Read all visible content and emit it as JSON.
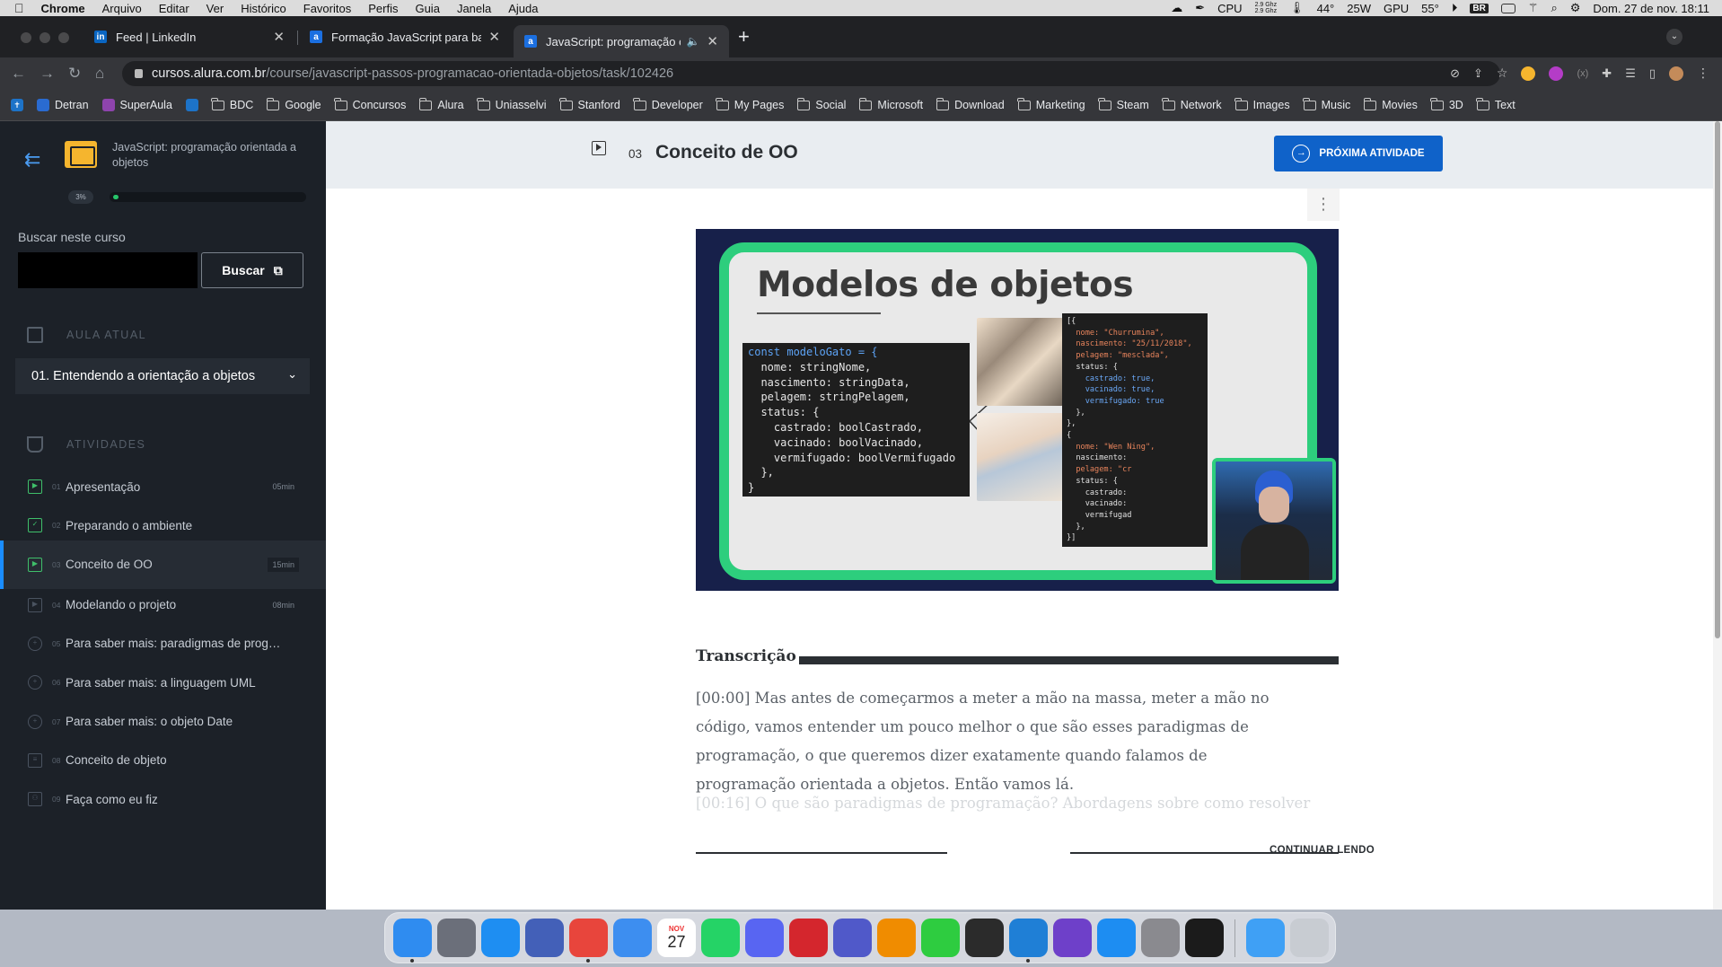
{
  "menubar": {
    "app": "Chrome",
    "menus": [
      "Arquivo",
      "Editar",
      "Ver",
      "Histórico",
      "Favoritos",
      "Perfis",
      "Guia",
      "Janela",
      "Ajuda"
    ],
    "cpu_label": "CPU",
    "cpu_freq_1": "2.9 Ghz",
    "cpu_freq_2": "2.9 Ghz",
    "temp": "44°",
    "power": "25W",
    "gpu_label": "GPU",
    "gpu_temp": "55°",
    "keyboard": "BR",
    "datetime": "Dom. 27 de nov.  18:11"
  },
  "tabs": [
    {
      "title": "Feed | LinkedIn",
      "favicon": "linkedin-icon",
      "color": "#0a66c2"
    },
    {
      "title": "Formação JavaScript para back-end",
      "favicon": "alura-icon",
      "color": "#1b6fe0"
    },
    {
      "title": "JavaScript: programação orientada",
      "favicon": "alura-icon",
      "color": "#1b6fe0",
      "active": true
    }
  ],
  "omnibox": {
    "host": "cursos.alura.com.br",
    "path": "/course/javascript-passos-programacao-orientada-objetos/task/102426"
  },
  "bookmarks": [
    {
      "label": "",
      "type": "plus"
    },
    {
      "label": "Detran",
      "type": "fav",
      "color": "#2a6bd1"
    },
    {
      "label": "SuperAula",
      "type": "fav",
      "color": "#8e44ad"
    },
    {
      "label": "",
      "type": "fav",
      "color": "#1d73c8"
    },
    {
      "label": "BDC",
      "type": "folder"
    },
    {
      "label": "Google",
      "type": "folder"
    },
    {
      "label": "Concursos",
      "type": "folder"
    },
    {
      "label": "Alura",
      "type": "folder"
    },
    {
      "label": "Uniasselvi",
      "type": "folder"
    },
    {
      "label": "Stanford",
      "type": "folder"
    },
    {
      "label": "Developer",
      "type": "folder"
    },
    {
      "label": "My Pages",
      "type": "folder"
    },
    {
      "label": "Social",
      "type": "folder"
    },
    {
      "label": "Microsoft",
      "type": "folder"
    },
    {
      "label": "Download",
      "type": "folder"
    },
    {
      "label": "Marketing",
      "type": "folder"
    },
    {
      "label": "Steam",
      "type": "folder"
    },
    {
      "label": "Network",
      "type": "folder"
    },
    {
      "label": "Images",
      "type": "folder"
    },
    {
      "label": "Music",
      "type": "folder"
    },
    {
      "label": "Movies",
      "type": "folder"
    },
    {
      "label": "3D",
      "type": "folder"
    },
    {
      "label": "Text",
      "type": "folder"
    }
  ],
  "sidebar": {
    "course_title": "JavaScript: programação orientada a objetos",
    "progress_label": "3%",
    "progress_value": 0.03,
    "search_label": "Buscar neste curso",
    "search_placeholder": "",
    "search_button": "Buscar",
    "current_lesson_heading": "AULA ATUAL",
    "current_lesson": "01. Entendendo a orientação a objetos",
    "activities_heading": "ATIVIDADES",
    "activities": [
      {
        "num": "01",
        "label": "Apresentação",
        "duration": "05min",
        "icon": "video-icon",
        "done": true
      },
      {
        "num": "02",
        "label": "Preparando o ambiente",
        "duration": "",
        "icon": "clipboard-icon",
        "done": true
      },
      {
        "num": "03",
        "label": "Conceito de OO",
        "duration": "15min",
        "icon": "video-icon",
        "done": true,
        "active": true
      },
      {
        "num": "04",
        "label": "Modelando o projeto",
        "duration": "08min",
        "icon": "video-icon",
        "done": false
      },
      {
        "num": "05",
        "label": "Para saber mais: paradigmas de progr...",
        "duration": "",
        "icon": "plus-circle-icon",
        "done": false
      },
      {
        "num": "06",
        "label": "Para saber mais: a linguagem UML",
        "duration": "",
        "icon": "plus-circle-icon",
        "done": false
      },
      {
        "num": "07",
        "label": "Para saber mais: o objeto Date",
        "duration": "",
        "icon": "plus-circle-icon",
        "done": false
      },
      {
        "num": "08",
        "label": "Conceito de objeto",
        "duration": "",
        "icon": "list-icon",
        "done": false
      },
      {
        "num": "09",
        "label": "Faça como eu fiz",
        "duration": "",
        "icon": "people-icon",
        "done": false
      }
    ]
  },
  "main": {
    "task_number": "03",
    "task_title": "Conceito de OO",
    "next_button": "PRÓXIMA ATIVIDADE",
    "video": {
      "slide_title": "Modelos de objetos",
      "code_lines": [
        "const modeloGato = {",
        "  nome: stringNome,",
        "  nascimento: stringData,",
        "  pelagem: stringPelagem,",
        "  status: {",
        "    castrado: boolCastrado,",
        "    vacinado: boolVacinado,",
        "    vermifugado: boolVermifugado",
        "  },",
        "}"
      ],
      "json_lines": [
        "[{",
        "  nome: \"Churrumina\",",
        "  nascimento: \"25/11/2018\",",
        "  pelagem: \"mesclada\",",
        "  status: {",
        "    castrado: true,",
        "    vacinado: true,",
        "    vermifugado: true",
        "  },",
        "},",
        "{",
        "  nome: \"Wen Ning\",",
        "  nascimento:",
        "  pelagem: \"cr",
        "  status: {",
        "    castrado:",
        "    vacinado:",
        "    vermifugad",
        "  },",
        "}]"
      ]
    },
    "transcript_heading": "Transcrição",
    "transcript_p1": "[00:00] Mas antes de começarmos a meter a mão na massa, meter a mão no código, vamos entender um pouco melhor o que são esses paradigmas de programação, o que queremos dizer exatamente quando falamos de programação orientada a objetos. Então vamos lá.",
    "transcript_p2": "[00:16] O que são paradigmas de programação? Abordagens sobre como resolver",
    "continue_label": "CONTINUAR LENDO"
  },
  "dock": {
    "calendar_month": "NOV",
    "calendar_day": "27",
    "apps": [
      {
        "name": "finder",
        "color": "#2f8cf0"
      },
      {
        "name": "launchpad",
        "color": "#6b6f7a"
      },
      {
        "name": "safari",
        "color": "#1e8ef2"
      },
      {
        "name": "nordvpn",
        "color": "#4360b8"
      },
      {
        "name": "chrome",
        "color": "#e8453c"
      },
      {
        "name": "mail",
        "color": "#3d8ef0"
      },
      {
        "name": "calendar",
        "color": "#ffffff"
      },
      {
        "name": "whatsapp",
        "color": "#25d366"
      },
      {
        "name": "discord",
        "color": "#5865f2"
      },
      {
        "name": "acrobat",
        "color": "#d4262d"
      },
      {
        "name": "teams",
        "color": "#5059c9"
      },
      {
        "name": "vlc",
        "color": "#f08c00"
      },
      {
        "name": "feather",
        "color": "#2ecc40"
      },
      {
        "name": "activity",
        "color": "#2b2b2b"
      },
      {
        "name": "vscode",
        "color": "#1f7fd6"
      },
      {
        "name": "github",
        "color": "#6e40c9"
      },
      {
        "name": "appstore",
        "color": "#1d8df2"
      },
      {
        "name": "settings",
        "color": "#8a8a8f"
      },
      {
        "name": "terminal",
        "color": "#1b1b1b"
      },
      {
        "name": "downloads",
        "color": "#3fa0f5"
      },
      {
        "name": "trash",
        "color": "#c8ccd2"
      }
    ]
  }
}
